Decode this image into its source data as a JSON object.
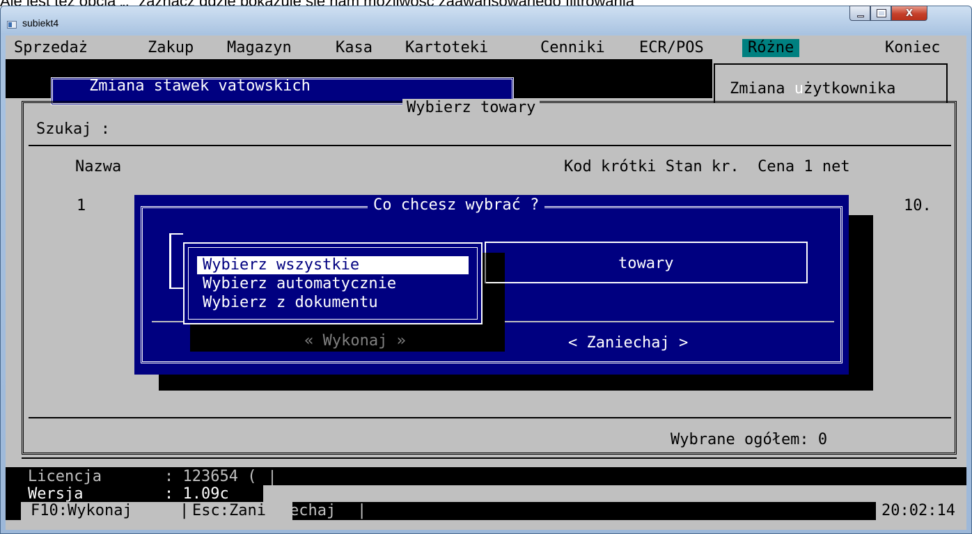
{
  "caption": "Ale jest też opcja „.” zaznacz gdzie pokazuje się nam możliwość zaawansowanego filtrowania",
  "window": {
    "title": "subiekt4",
    "close_glyph": "X"
  },
  "menu": {
    "items": [
      "Sprzedaż",
      "Zakup",
      "Magazyn",
      "Kasa",
      "Kartoteki",
      "Cenniki",
      "ECR/POS",
      "Różne",
      "Koniec"
    ],
    "active": "Różne"
  },
  "vat_dialog": {
    "title": "Zmiana stawek vatowskich"
  },
  "user_menu": {
    "label_pre": "Zmiana ",
    "label_hot": "u",
    "label_post": "żytkownika"
  },
  "panel": {
    "title": "Wybierz towary",
    "search_label": "Szukaj :",
    "columns": {
      "name": "Nazwa",
      "rest": "Kod krótki Stan kr.  Cena 1 net"
    },
    "rows": [
      {
        "num": "1",
        "price": "10."
      }
    ],
    "total": "Wybrane ogółem: 0"
  },
  "dialog": {
    "title": "Co chcesz wybrać ?",
    "options": [
      "Wybierz wszystkie",
      "Wybierz automatycznie",
      "Wybierz z dokumentu"
    ],
    "type_value": "towary",
    "execute_label": "« Wykonaj »",
    "cancel_label": "< Zaniechaj >"
  },
  "status": {
    "license_label": "Licencja",
    "license_value": ": 123654 (",
    "version_label": "Wersja",
    "version_value": ": 1.09c",
    "f10": "F10:Wykonaj",
    "separator": "|",
    "esc_a": "Esc:Zani",
    "esc_b": "echaj",
    "clock": "20:02:14"
  },
  "colors": {
    "console_bg": "#c0c0c0",
    "dialog_bg": "#000080",
    "menu_active": "#008080"
  }
}
